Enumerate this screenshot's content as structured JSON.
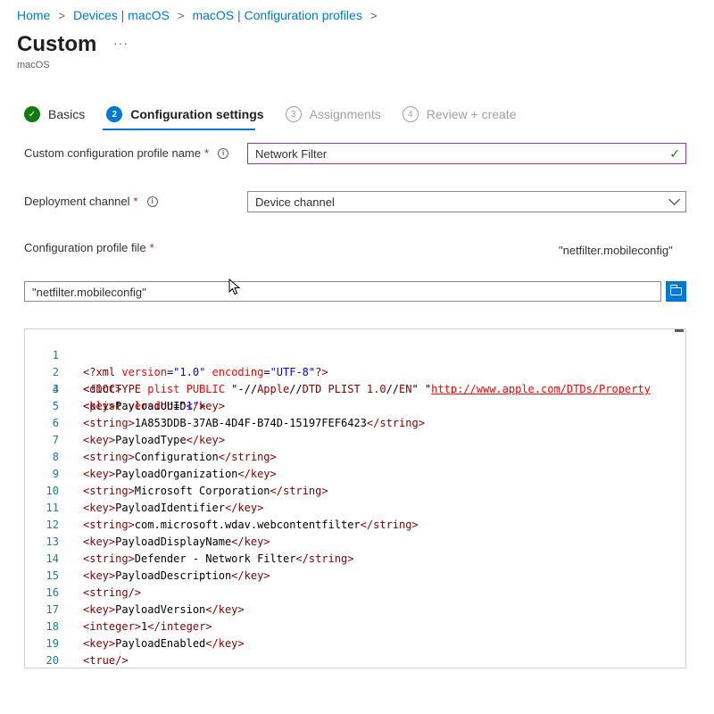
{
  "breadcrumb": [
    "Home",
    "Devices | macOS",
    "macOS | Configuration profiles"
  ],
  "page": {
    "title": "Custom",
    "more": "···",
    "subtitle": "macOS"
  },
  "wizard": {
    "steps": [
      {
        "num": "✓",
        "label": "Basics",
        "state": "done"
      },
      {
        "num": "2",
        "label": "Configuration settings",
        "state": "active"
      },
      {
        "num": "3",
        "label": "Assignments",
        "state": "pending"
      },
      {
        "num": "4",
        "label": "Review + create",
        "state": "pending"
      }
    ]
  },
  "form": {
    "profile_name_label": "Custom configuration profile name",
    "profile_name_value": "Network Filter",
    "deployment_label": "Deployment channel",
    "deployment_value": "Device channel",
    "profile_file_label": "Configuration profile file",
    "profile_file_name": "\"netfilter.mobileconfig\"",
    "file_input_value": "\"netfilter.mobileconfig\"",
    "required_mark": "*",
    "info_glyph": "i"
  },
  "editor": {
    "lines": [
      "1",
      "2",
      "3",
      "4",
      "5",
      "6",
      "7",
      "8",
      "9",
      "10",
      "11",
      "12",
      "13",
      "14",
      "15",
      "16",
      "17",
      "18",
      "19",
      "20"
    ],
    "code": {
      "l1_a": "<?xml ",
      "l1_b": "version",
      "l1_c": "=",
      "l1_d": "\"1.0\"",
      "l1_e": " encoding",
      "l1_f": "=",
      "l1_g": "\"UTF-8\"",
      "l1_h": "?>",
      "l2_a": "<!DOCTYPE ",
      "l2_b": "plist PUBLIC ",
      "l2_c": "\"-//",
      "l2_d": "Apple",
      "l2_e": "//",
      "l2_f": "DTD PLIST 1.0",
      "l2_g": "//",
      "l2_h": "EN",
      "l2_i": "\" \"",
      "l2_j": "http://www.apple.com/DTDs/Property",
      "l3_a": "<plist ",
      "l3_b": "version",
      "l3_c": "=",
      "l3_d": "\"1\"",
      "l3_e": ">",
      "l4": "<dict>",
      "l5": "<key>PayloadUUID</key>",
      "l6": "<string>1A853DDB-37AB-4D4F-B74D-15197FEF6423</string>",
      "l7": "<key>PayloadType</key>",
      "l8": "<string>Configuration</string>",
      "l9": "<key>PayloadOrganization</key>",
      "l10": "<string>Microsoft Corporation</string>",
      "l11": "<key>PayloadIdentifier</key>",
      "l12": "<string>com.microsoft.wdav.webcontentfilter</string>",
      "l13": "<key>PayloadDisplayName</key>",
      "l14": "<string>Defender - Network Filter</string>",
      "l15": "<key>PayloadDescription</key>",
      "l16": "<string/>",
      "l17": "<key>PayloadVersion</key>",
      "l18": "<integer>1</integer>",
      "l19": "<key>PayloadEnabled</key>",
      "l20": "<true/>"
    }
  },
  "colors": {
    "accent": "#0078d4",
    "success": "#107c10",
    "required": "#a4262c",
    "focus_border": "#8a3a9d"
  }
}
